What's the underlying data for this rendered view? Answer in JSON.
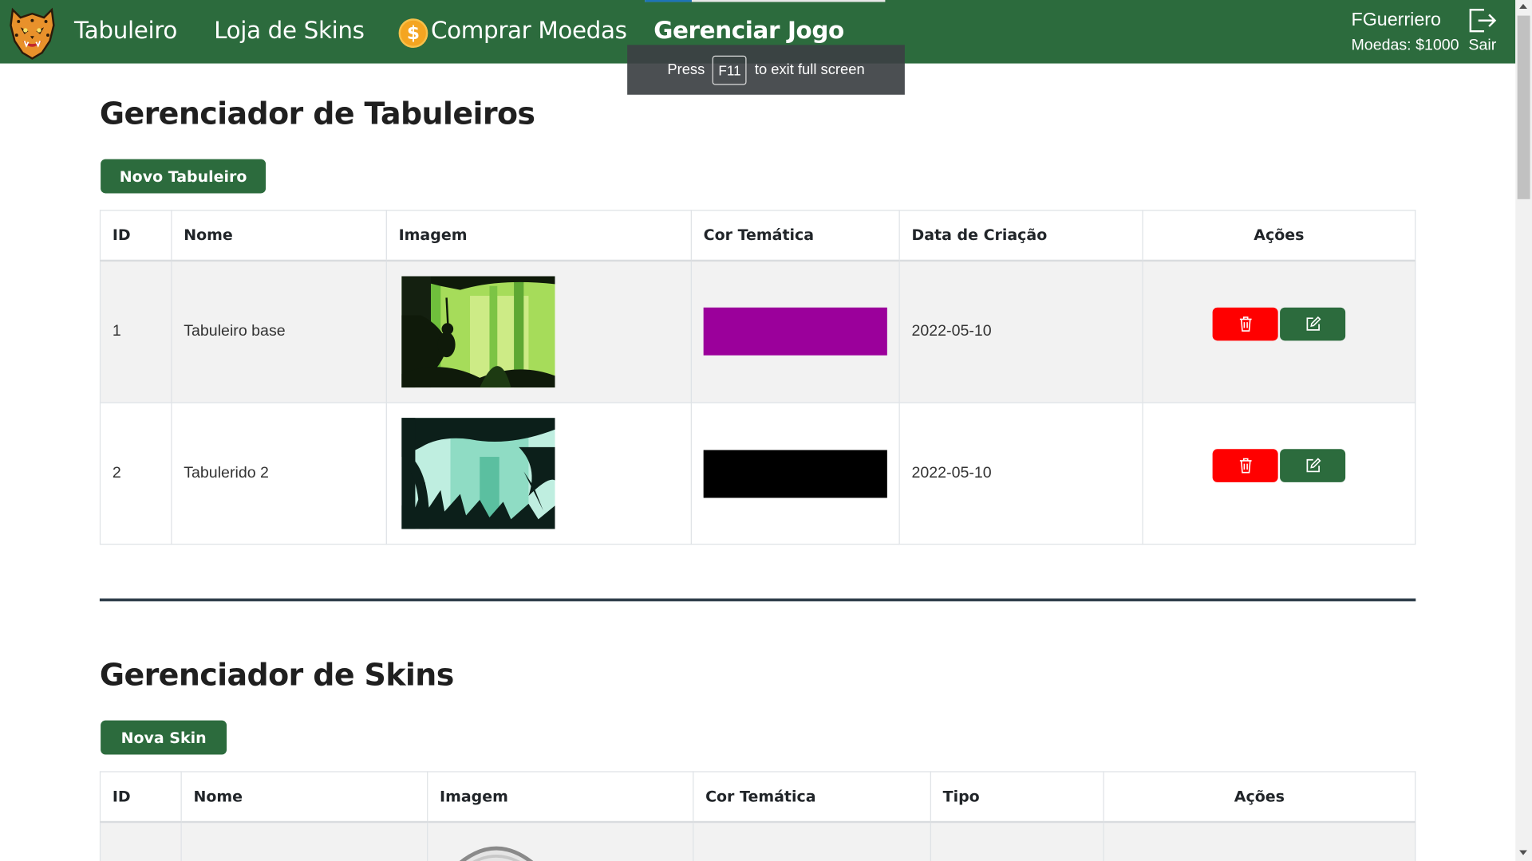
{
  "nav": {
    "links": [
      {
        "label": "Tabuleiro"
      },
      {
        "label": "Loja de Skins"
      },
      {
        "label": "Comprar Moedas"
      },
      {
        "label": "Gerenciar Jogo"
      }
    ],
    "coin_symbol": "$",
    "user_name": "FGuerriero",
    "user_coins": "Moedas: $1000",
    "logout_label": "Sair"
  },
  "fullscreen_toast": {
    "press": "Press",
    "key": "F11",
    "rest": "to exit full screen"
  },
  "boards": {
    "title": "Gerenciador de Tabuleiros",
    "new_button": "Novo Tabuleiro",
    "columns": [
      "ID",
      "Nome",
      "Imagem",
      "Cor Temática",
      "Data de Criação",
      "Ações"
    ],
    "rows": [
      {
        "id": "1",
        "name": "Tabuleiro base",
        "color": "#9b009b",
        "date": "2022-05-10",
        "image": "jungle-green"
      },
      {
        "id": "2",
        "name": "Tabulerido 2",
        "color": "#000000",
        "date": "2022-05-10",
        "image": "jungle-teal"
      }
    ]
  },
  "skins": {
    "title": "Gerenciador de Skins",
    "new_button": "Nova Skin",
    "columns": [
      "ID",
      "Nome",
      "Imagem",
      "Cor Temática",
      "Tipo",
      "Ações"
    ]
  },
  "colors": {
    "brand_green": "#2c6b3d",
    "delete_red": "#ff0000"
  }
}
